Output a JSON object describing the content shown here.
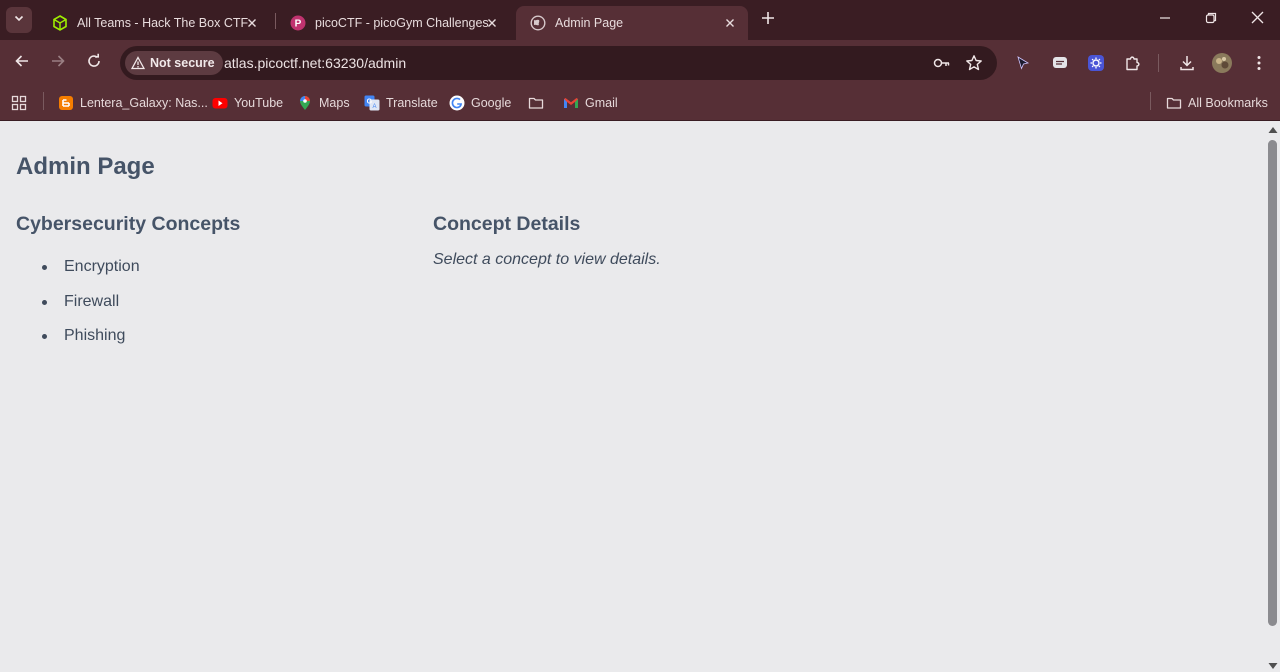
{
  "browser": {
    "tabs": [
      {
        "title": "All Teams - Hack The Box CTF",
        "icon": "hackthebox-cube-icon",
        "active": false
      },
      {
        "title": "picoCTF - picoGym Challenges",
        "icon": "picoctf-icon",
        "active": false
      },
      {
        "title": "Admin Page",
        "icon": "globe-icon",
        "active": true
      }
    ],
    "address": {
      "security_label": "Not secure",
      "url": "atlas.picoctf.net:63230/admin"
    },
    "bookmarks": [
      {
        "label": "Lentera_Galaxy: Nas...",
        "icon": "blogger-icon"
      },
      {
        "label": "YouTube",
        "icon": "youtube-icon"
      },
      {
        "label": "Maps",
        "icon": "maps-pin-icon"
      },
      {
        "label": "Translate",
        "icon": "translate-icon"
      },
      {
        "label": "Google",
        "icon": "google-icon"
      },
      {
        "label": "",
        "icon": "folder-icon"
      },
      {
        "label": "Gmail",
        "icon": "gmail-icon"
      }
    ],
    "all_bookmarks_label": "All Bookmarks",
    "colors": {
      "tabstrip": "#3a1d23",
      "toolbar": "#562f36",
      "omnibox": "#331a1f"
    }
  },
  "page": {
    "title": "Admin Page",
    "concepts": {
      "heading": "Cybersecurity Concepts",
      "items": [
        "Encryption",
        "Firewall",
        "Phishing"
      ]
    },
    "details": {
      "heading": "Concept Details",
      "hint": "Select a concept to view details."
    },
    "colors": {
      "background": "#eaeaec",
      "heading_text": "#465468",
      "body_text": "#3f4b5c"
    }
  }
}
